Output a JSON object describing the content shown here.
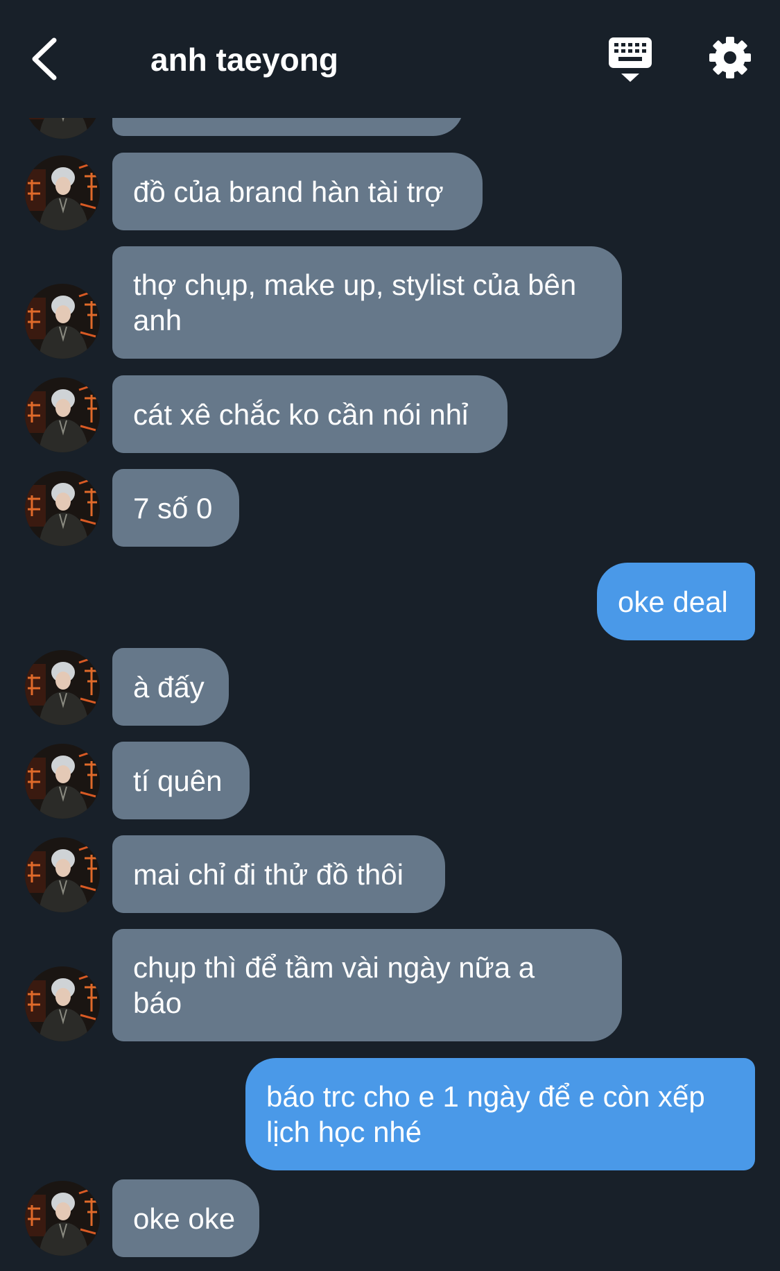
{
  "header": {
    "title": "anh taeyong",
    "back_icon": "chevron-left-icon",
    "keyboard_icon": "keyboard-icon",
    "settings_icon": "gear-icon"
  },
  "colors": {
    "background": "#182029",
    "received_bubble": "#66788a",
    "sent_bubble": "#4a99e8",
    "text": "#ffffff"
  },
  "messages": [
    {
      "from": "other",
      "text": "đồ của brand hàn tài trợ"
    },
    {
      "from": "other",
      "text": "thợ chụp, make up, stylist của bên anh"
    },
    {
      "from": "other",
      "text": "cát xê chắc ko cần nói nhỉ"
    },
    {
      "from": "other",
      "text": "7 số 0"
    },
    {
      "from": "me",
      "text": "oke deal"
    },
    {
      "from": "other",
      "text": "à đấy"
    },
    {
      "from": "other",
      "text": "tí quên"
    },
    {
      "from": "other",
      "text": "mai chỉ đi thử đồ thôi"
    },
    {
      "from": "other",
      "text": "chụp thì để tầm vài ngày nữa a báo"
    },
    {
      "from": "me",
      "text": "báo trc cho e 1 ngày để e còn xếp lịch học nhé"
    },
    {
      "from": "other",
      "text": "oke oke"
    }
  ]
}
